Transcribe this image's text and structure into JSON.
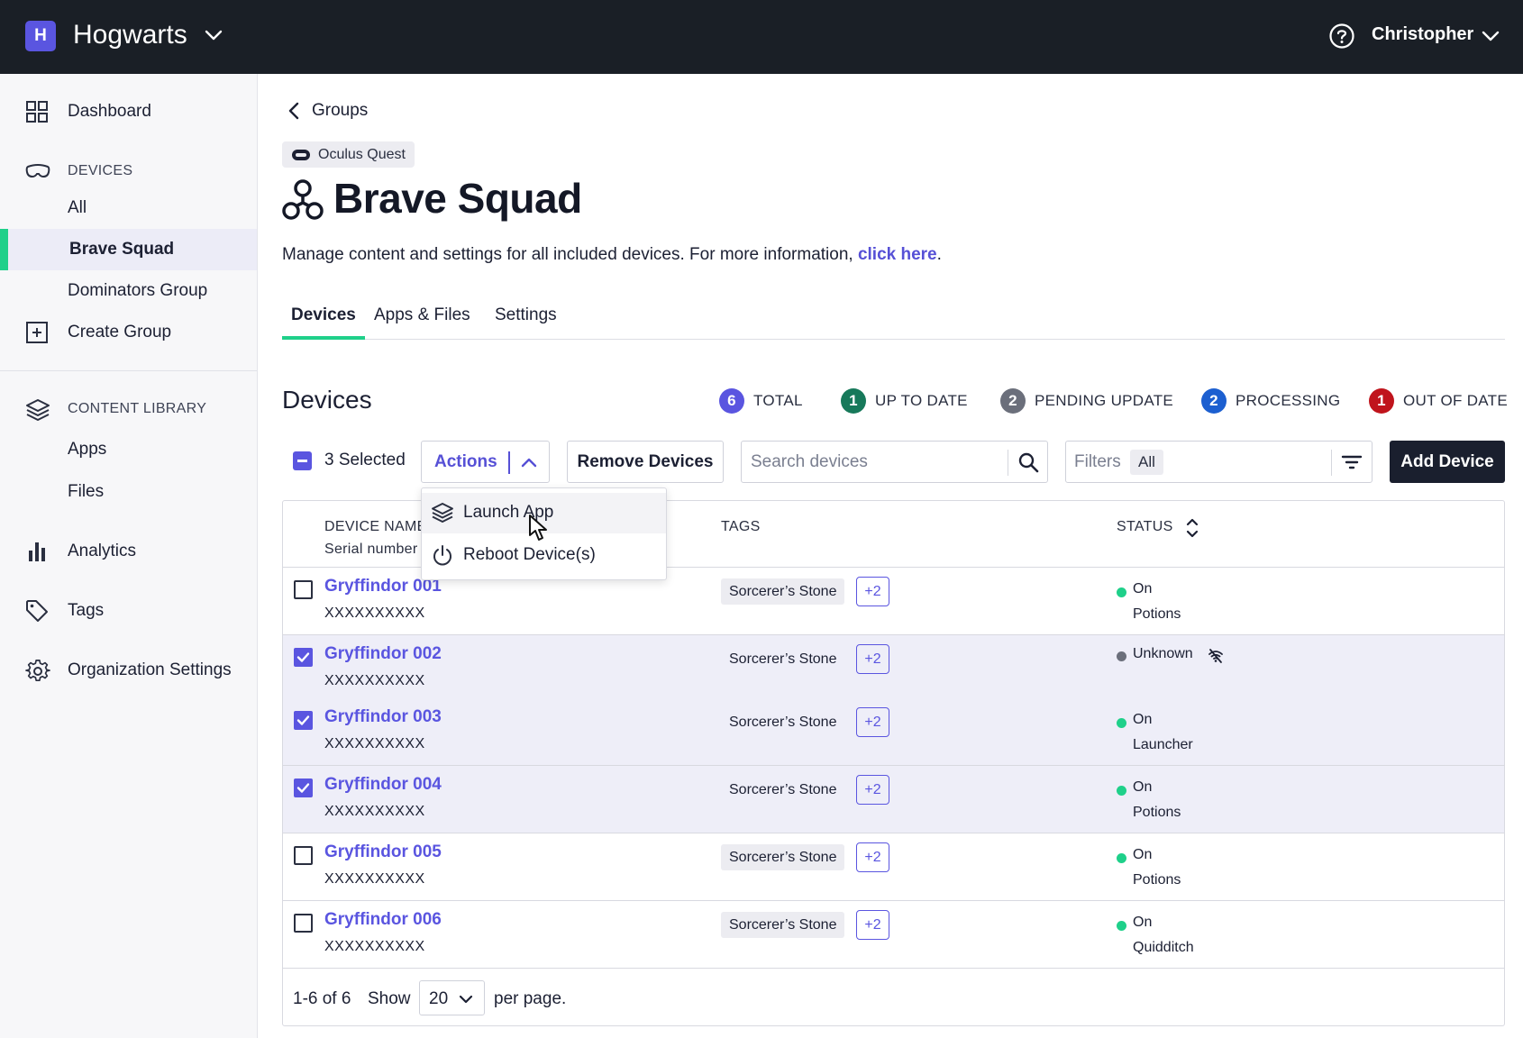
{
  "topbar": {
    "org_initial": "H",
    "org_name": "Hogwarts",
    "user_name": "Christopher"
  },
  "sidebar": {
    "dashboard": "Dashboard",
    "devices_section": "DEVICES",
    "devices_items": [
      "All",
      "Brave Squad",
      "Dominators Group"
    ],
    "active_item": "Brave Squad",
    "create_group": "Create Group",
    "content_section": "CONTENT LIBRARY",
    "content_items": [
      "Apps",
      "Files"
    ],
    "analytics": "Analytics",
    "tags": "Tags",
    "org_settings": "Organization Settings"
  },
  "header": {
    "back_label": "Groups",
    "platform": "Oculus Quest",
    "title": "Brave Squad",
    "description": "Manage content and settings for all included devices. For more information, ",
    "link_text": "click here",
    "description_end": "."
  },
  "tabs": [
    "Devices",
    "Apps & Files",
    "Settings"
  ],
  "active_tab": "Devices",
  "devices": {
    "section_title": "Devices",
    "stats": [
      {
        "count": "6",
        "label": "TOTAL",
        "color": "#5a55e0"
      },
      {
        "count": "1",
        "label": "UP TO DATE",
        "color": "#17795a"
      },
      {
        "count": "2",
        "label": "PENDING UPDATE",
        "color": "#6b6f7b"
      },
      {
        "count": "2",
        "label": "PROCESSING",
        "color": "#1c5fd0"
      },
      {
        "count": "1",
        "label": "OUT OF DATE",
        "color": "#c0141c"
      }
    ],
    "selected_text": "3 Selected",
    "actions_label": "Actions",
    "remove_label": "Remove Devices",
    "search_placeholder": "Search devices",
    "filters_label": "Filters",
    "filters_value": "All",
    "add_label": "Add Device"
  },
  "actions_menu": [
    {
      "label": "Launch App",
      "icon": "layers-icon"
    },
    {
      "label": "Reboot Device(s)",
      "icon": "power-icon"
    }
  ],
  "table": {
    "col_name": "DEVICE NAME",
    "col_serial": "Serial number",
    "col_tags": "TAGS",
    "col_status": "STATUS",
    "rows": [
      {
        "name": "Gryffindor 001",
        "serial": "XXXXXXXXXX",
        "tag": "Sorcerer’s Stone",
        "more": "+2",
        "status": "On",
        "sub": "Potions",
        "checked": false,
        "status_color": "#1fd08a"
      },
      {
        "name": "Gryffindor 002",
        "serial": "XXXXXXXXXX",
        "tag": "Sorcerer’s Stone",
        "more": "+2",
        "status": "Unknown",
        "sub": "",
        "checked": true,
        "status_color": "#6b6f7b"
      },
      {
        "name": "Gryffindor 003",
        "serial": "XXXXXXXXXX",
        "tag": "Sorcerer’s Stone",
        "more": "+2",
        "status": "On",
        "sub": "Launcher",
        "checked": true,
        "status_color": "#1fd08a"
      },
      {
        "name": "Gryffindor 004",
        "serial": "XXXXXXXXXX",
        "tag": "Sorcerer’s Stone",
        "more": "+2",
        "status": "On",
        "sub": "Potions",
        "checked": true,
        "status_color": "#1fd08a"
      },
      {
        "name": "Gryffindor 005",
        "serial": "XXXXXXXXXX",
        "tag": "Sorcerer’s Stone",
        "more": "+2",
        "status": "On",
        "sub": "Potions",
        "checked": false,
        "status_color": "#1fd08a"
      },
      {
        "name": "Gryffindor 006",
        "serial": "XXXXXXXXXX",
        "tag": "Sorcerer’s Stone",
        "more": "+2",
        "status": "On",
        "sub": "Quidditch",
        "checked": false,
        "status_color": "#1fd08a"
      }
    ]
  },
  "pagination": {
    "range": "1-6 of 6",
    "show": "Show",
    "per_page_value": "20",
    "per_page": "per page."
  }
}
